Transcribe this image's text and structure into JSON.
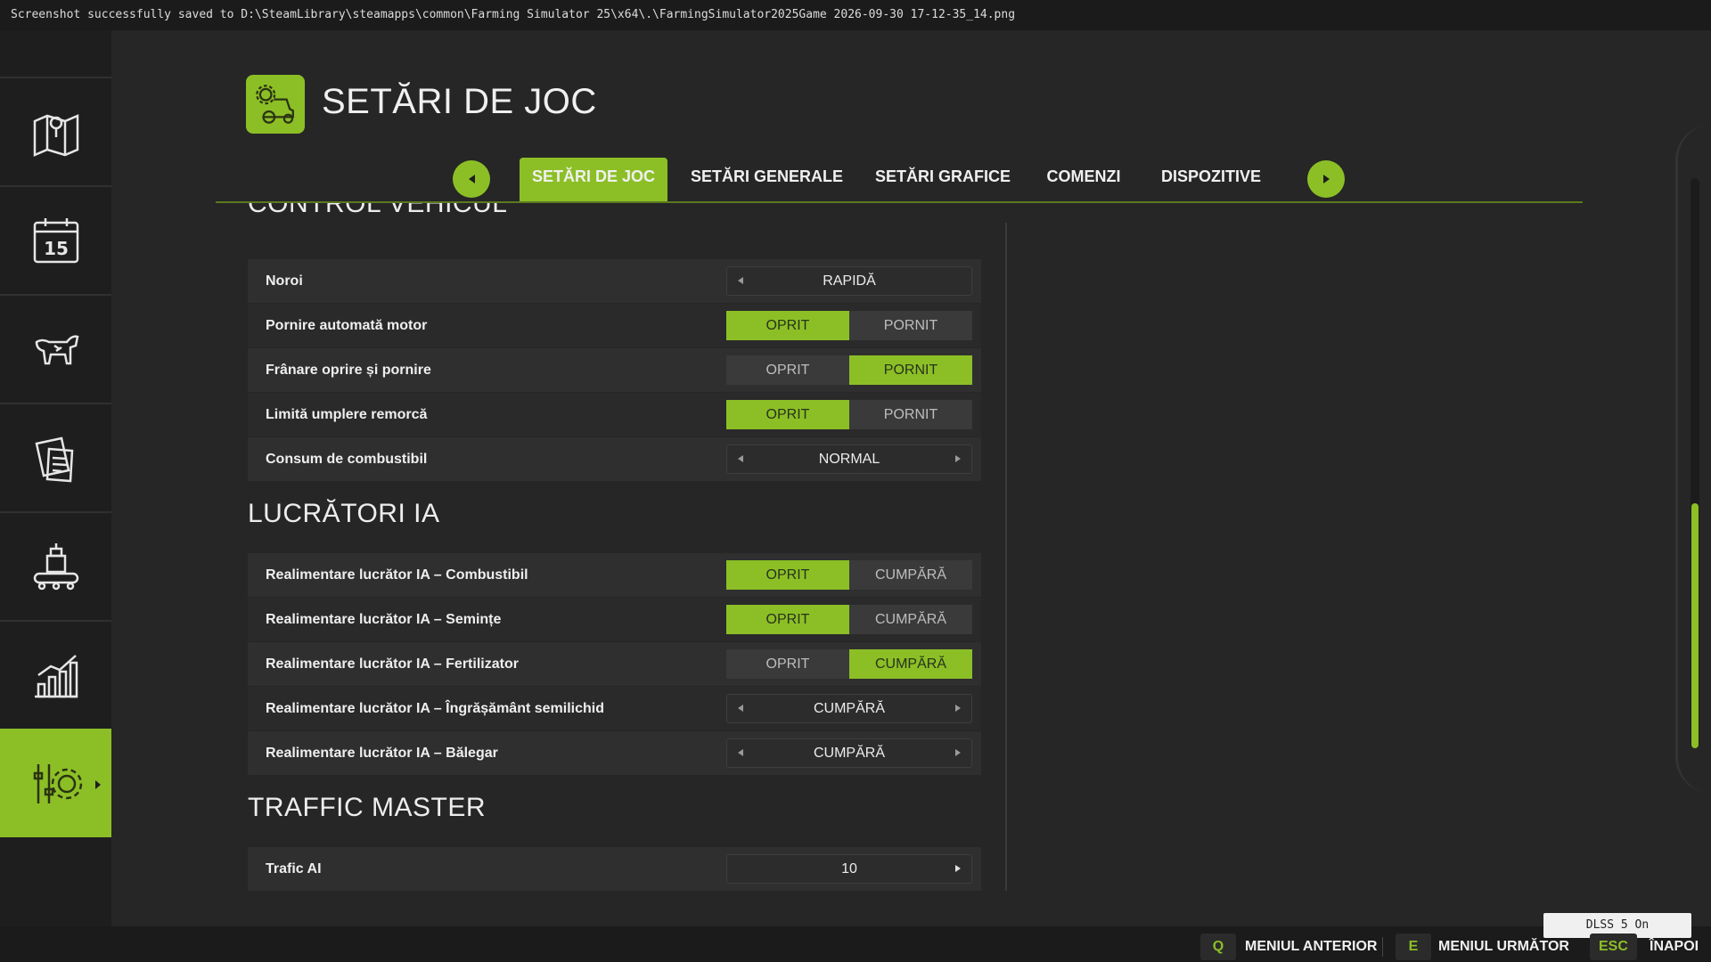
{
  "notice": "Screenshot successfully saved to D:\\SteamLibrary\\steamapps\\common\\Farming Simulator 25\\x64\\.\\FarmingSimulator2025Game 2026-09-30 17-12-35_14.png",
  "sidebar": {
    "items": [
      {
        "icon": "map-icon"
      },
      {
        "icon": "calendar-icon",
        "text": "15"
      },
      {
        "icon": "animals-icon"
      },
      {
        "icon": "contracts-icon"
      },
      {
        "icon": "production-icon"
      },
      {
        "icon": "statistics-icon"
      },
      {
        "icon": "settings-icon",
        "active": true
      }
    ]
  },
  "header": {
    "title": "SETĂRI DE JOC",
    "icon": "tractor-gear-icon"
  },
  "tabs": [
    {
      "label": "SETĂRI DE JOC",
      "active": true
    },
    {
      "label": "SETĂRI GENERALE"
    },
    {
      "label": "SETĂRI GRAFICE"
    },
    {
      "label": "COMENZI"
    },
    {
      "label": "DISPOZITIVE"
    }
  ],
  "sections": {
    "vehicle": {
      "title": "CONTROL VEHICUL",
      "rows": [
        {
          "label": "Noroi",
          "type": "stepper",
          "value": "RAPIDĂ"
        },
        {
          "label": "Pornire automată motor",
          "type": "toggle",
          "options": [
            "OPRIT",
            "PORNIT"
          ],
          "selected": 0
        },
        {
          "label": "Frânare oprire și pornire",
          "type": "toggle",
          "options": [
            "OPRIT",
            "PORNIT"
          ],
          "selected": 1
        },
        {
          "label": "Limită umplere remorcă",
          "type": "toggle",
          "options": [
            "OPRIT",
            "PORNIT"
          ],
          "selected": 0
        },
        {
          "label": "Consum de combustibil",
          "type": "stepper",
          "value": "NORMAL"
        }
      ]
    },
    "ai_workers": {
      "title": "LUCRĂTORI IA",
      "rows": [
        {
          "label": "Realimentare lucrător IA – Combustibil",
          "type": "toggle",
          "options": [
            "OPRIT",
            "CUMPĂRĂ"
          ],
          "selected": 0
        },
        {
          "label": "Realimentare lucrător IA – Semințe",
          "type": "toggle",
          "options": [
            "OPRIT",
            "CUMPĂRĂ"
          ],
          "selected": 0
        },
        {
          "label": "Realimentare lucrător IA – Fertilizator",
          "type": "toggle",
          "options": [
            "OPRIT",
            "CUMPĂRĂ"
          ],
          "selected": 1
        },
        {
          "label": "Realimentare lucrător IA – Îngrășământ semilichid",
          "type": "stepper",
          "value": "CUMPĂRĂ"
        },
        {
          "label": "Realimentare lucrător IA – Bălegar",
          "type": "stepper",
          "value": "CUMPĂRĂ"
        }
      ]
    },
    "traffic": {
      "title": "TRAFFIC MASTER",
      "rows": [
        {
          "label": "Trafic AI",
          "type": "stepper",
          "value": "10"
        }
      ]
    }
  },
  "footer": {
    "prev_key": "Q",
    "prev_label": "MENIUL ANTERIOR",
    "next_key": "E",
    "next_label": "MENIUL URMĂTOR",
    "back_key": "ESC",
    "back_label": "ÎNAPOI"
  },
  "dlss": "DLSS 5 On",
  "colors": {
    "accent": "#8cbf26",
    "background": "#262626",
    "row": "#2f2f2f"
  }
}
